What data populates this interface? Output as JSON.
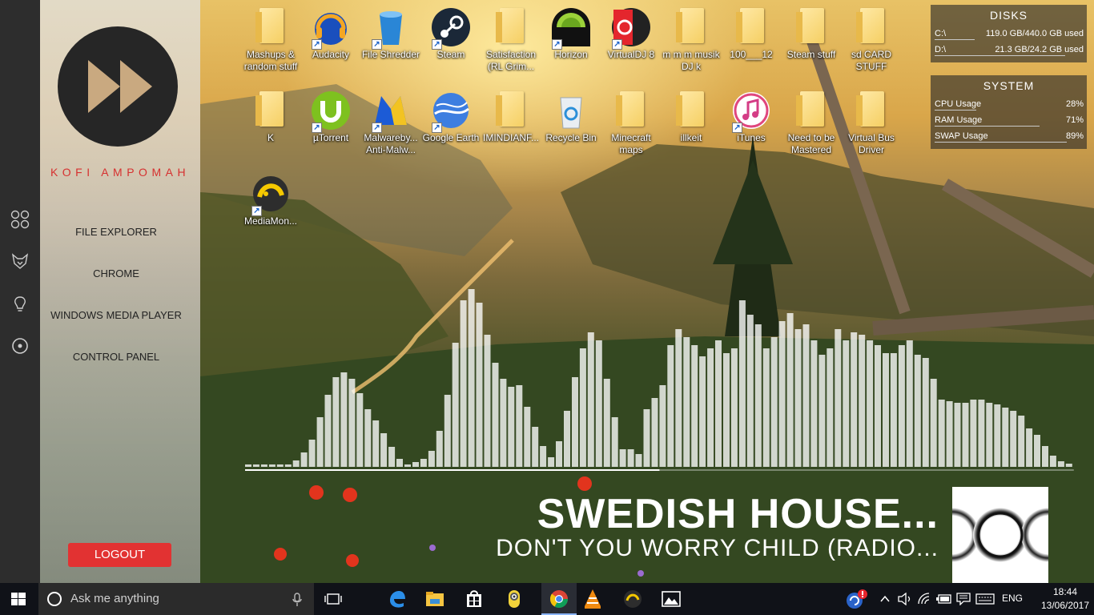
{
  "side_panel": {
    "user_name": "KOFI AMPOMAH",
    "menu": [
      "FILE EXPLORER",
      "CHROME",
      "WINDOWS MEDIA PLAYER",
      "CONTROL PANEL"
    ],
    "logout_label": "LOGOUT"
  },
  "left_strip_icons": [
    "apps-grid-icon",
    "fox-icon",
    "lightbulb-icon",
    "record-icon"
  ],
  "desktop_icons": [
    {
      "label": "Mashups & random stuff",
      "icon": "folder-icon"
    },
    {
      "label": "Audacity",
      "icon": "audacity-icon"
    },
    {
      "label": "File Shredder",
      "icon": "file-shredder-icon"
    },
    {
      "label": "Steam",
      "icon": "steam-icon"
    },
    {
      "label": "Satisfaction (RL Grim...",
      "icon": "folder-icon"
    },
    {
      "label": "Horizon",
      "icon": "horizon-icon"
    },
    {
      "label": "VirtualDJ 8",
      "icon": "virtualdj-icon"
    },
    {
      "label": "m m m musik DJ k",
      "icon": "folder-icon"
    },
    {
      "label": "100___12",
      "icon": "folder-icon"
    },
    {
      "label": "Steam stuff",
      "icon": "folder-icon"
    },
    {
      "label": "sd CARD STUFF",
      "icon": "folder-icon"
    },
    {
      "label": "K",
      "icon": "folder-icon"
    },
    {
      "label": "µTorrent",
      "icon": "utorrent-icon"
    },
    {
      "label": "Malwareby... Anti-Malw...",
      "icon": "malwarebytes-icon"
    },
    {
      "label": "Google Earth",
      "icon": "google-earth-icon"
    },
    {
      "label": "IMINDIANF...",
      "icon": "folder-icon"
    },
    {
      "label": "Recycle Bin",
      "icon": "recycle-bin-icon"
    },
    {
      "label": "Minecraft maps",
      "icon": "folder-icon"
    },
    {
      "label": "illkeit",
      "icon": "folder-icon"
    },
    {
      "label": "iTunes",
      "icon": "itunes-icon"
    },
    {
      "label": "Need to be Mastered",
      "icon": "folder-icon"
    },
    {
      "label": "Virtual Bus Driver",
      "icon": "folder-icon"
    },
    {
      "label": "MediaMon...",
      "icon": "mediamonkey-icon"
    }
  ],
  "disks": {
    "title": "DISKS",
    "rows": [
      {
        "name": "C:\\",
        "value": "119.0 GB/440.0 GB used",
        "fraction": 0.27
      },
      {
        "name": "D:\\",
        "value": "21.3 GB/24.2 GB used",
        "fraction": 0.88
      }
    ]
  },
  "system": {
    "title": "SYSTEM",
    "rows": [
      {
        "name": "CPU Usage",
        "value": "28%",
        "fraction": 0.28
      },
      {
        "name": "RAM Usage",
        "value": "71%",
        "fraction": 0.71
      },
      {
        "name": "SWAP Usage",
        "value": "89%",
        "fraction": 0.89
      }
    ]
  },
  "now_playing": {
    "artist": "SWEDISH HOUSE...",
    "title": "DON'T YOU WORRY CHILD (RADIO...",
    "progress": 0.5
  },
  "visualizer_levels": [
    3,
    3,
    3,
    3,
    3,
    3,
    8,
    18,
    34,
    62,
    90,
    112,
    118,
    110,
    92,
    72,
    58,
    42,
    25,
    10,
    3,
    6,
    10,
    20,
    45,
    90,
    155,
    208,
    222,
    205,
    165,
    130,
    110,
    100,
    102,
    75,
    50,
    26,
    12,
    32,
    70,
    112,
    148,
    168,
    158,
    110,
    62,
    22,
    22,
    16,
    72,
    86,
    102,
    152,
    172,
    162,
    152,
    138,
    148,
    158,
    142,
    148,
    208,
    190,
    178,
    148,
    162,
    182,
    192,
    172,
    178,
    158,
    140,
    148,
    172,
    158,
    168,
    165,
    158,
    152,
    142,
    142,
    152,
    158,
    140,
    136,
    110,
    84,
    82,
    80,
    80,
    84,
    84,
    80,
    78,
    74,
    70,
    64,
    48,
    40,
    26,
    14,
    7,
    4
  ],
  "taskbar": {
    "search_placeholder": "Ask me anything",
    "language": "ENG",
    "time": "18:44",
    "date": "13/06/2017",
    "pinned": [
      "task-view-icon",
      "edge-icon",
      "file-explorer-icon",
      "store-icon",
      "minion-app-icon",
      "chrome-icon",
      "vlc-icon",
      "mediamonkey-icon",
      "photos-icon"
    ]
  }
}
